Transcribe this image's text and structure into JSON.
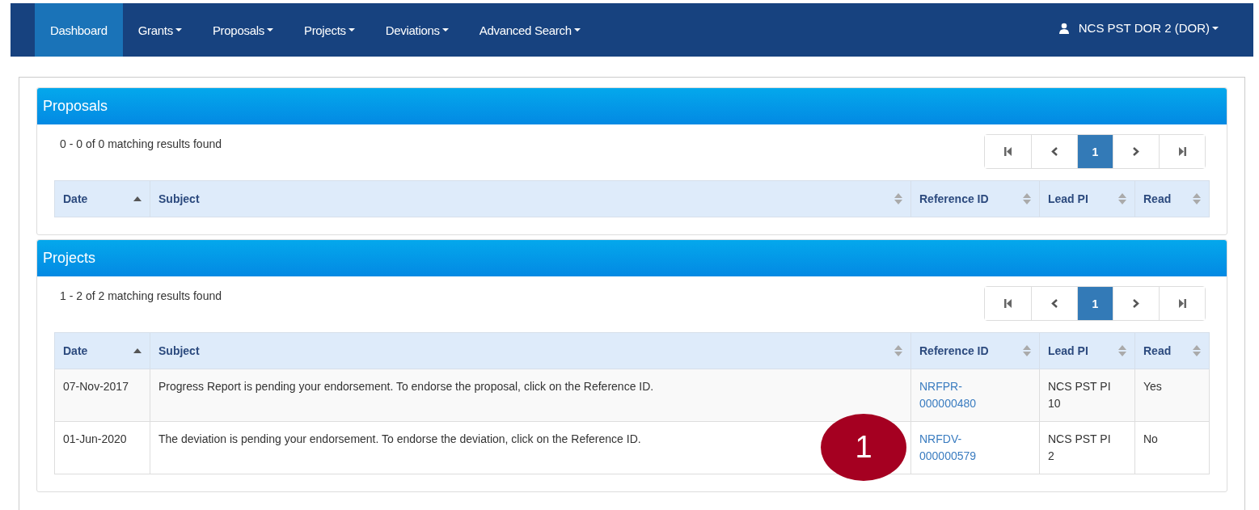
{
  "navbar": {
    "items": [
      {
        "label": "Dashboard",
        "selected": true,
        "dropdown": false
      },
      {
        "label": "Grants",
        "selected": false,
        "dropdown": true
      },
      {
        "label": "Proposals",
        "selected": false,
        "dropdown": true
      },
      {
        "label": "Projects",
        "selected": false,
        "dropdown": true
      },
      {
        "label": "Deviations",
        "selected": false,
        "dropdown": true
      },
      {
        "label": "Advanced Search",
        "selected": false,
        "dropdown": true
      }
    ],
    "user": "NCS PST DOR 2 (DOR)"
  },
  "panels": [
    {
      "title": "Proposals",
      "summary": "0 - 0 of 0 matching results found",
      "pagination": [
        {
          "kind": "first",
          "selected": false
        },
        {
          "kind": "prev",
          "selected": false
        },
        {
          "kind": "page",
          "label": "1",
          "selected": true
        },
        {
          "kind": "next",
          "selected": false
        },
        {
          "kind": "last",
          "selected": false
        }
      ],
      "columns": [
        {
          "label": "Date",
          "sorted": true
        },
        {
          "label": "Subject",
          "sorted": false
        },
        {
          "label": "Reference ID",
          "sorted": false
        },
        {
          "label": "Lead PI",
          "sorted": false
        },
        {
          "label": "Read",
          "sorted": false
        }
      ]
    },
    {
      "title": "Projects",
      "summary": "1 - 2 of 2 matching results found",
      "pagination": [
        {
          "kind": "first",
          "selected": false
        },
        {
          "kind": "prev",
          "selected": false
        },
        {
          "kind": "page",
          "label": "1",
          "selected": true
        },
        {
          "kind": "next",
          "selected": false
        },
        {
          "kind": "last",
          "selected": false
        }
      ],
      "columns": [
        {
          "label": "Date",
          "sorted": true
        },
        {
          "label": "Subject",
          "sorted": false
        },
        {
          "label": "Reference ID",
          "sorted": false
        },
        {
          "label": "Lead PI",
          "sorted": false
        },
        {
          "label": "Read",
          "sorted": false
        }
      ],
      "rows": [
        {
          "date": "07-Nov-2017",
          "subject": "Progress Report is pending your endorsement. To endorse the proposal, click on the Reference ID.",
          "reference_id": "NRFPR-000000480",
          "lead_pi": "NCS PST PI 10",
          "read": "Yes"
        },
        {
          "date": "01-Jun-2020",
          "subject": "The deviation is pending your endorsement. To endorse the deviation, click on the Reference ID.",
          "reference_id": "NRFDV-000000579",
          "lead_pi": "NCS PST PI 2",
          "read": "No"
        }
      ]
    }
  ],
  "callout": "1"
}
